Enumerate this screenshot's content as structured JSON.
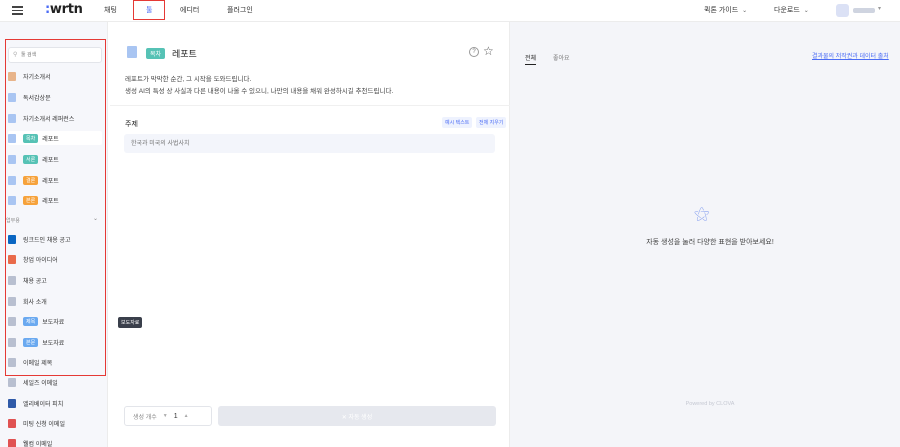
{
  "nav": {
    "logo_mark": ":",
    "logo_text": "wrtn",
    "tabs": [
      "채팅",
      "툴",
      "에디터",
      "플러그인"
    ],
    "active_tab": "툴",
    "quick_guide": "퀵톤 가이드",
    "download": "다운로드"
  },
  "sidebar": {
    "search_placeholder": "툴 검색",
    "items": [
      {
        "label": "자기소개서",
        "tag": "",
        "tag_color": "",
        "icon_color": "#e8b48a"
      },
      {
        "label": "독서감상문",
        "tag": "",
        "tag_color": "",
        "icon_color": "#a9c5f2"
      },
      {
        "label": "자기소개서 레퍼런스",
        "tag": "",
        "tag_color": "",
        "icon_color": "#a9c5f2"
      },
      {
        "label": "레포트",
        "tag": "목차",
        "tag_color": "#56c2b5",
        "icon_color": "#a9c5f2"
      },
      {
        "label": "레포트",
        "tag": "서론",
        "tag_color": "#56c2b5",
        "icon_color": "#a9c5f2"
      },
      {
        "label": "레포트",
        "tag": "결론",
        "tag_color": "#f6a23b",
        "icon_color": "#a9c5f2"
      },
      {
        "label": "레포트",
        "tag": "본론",
        "tag_color": "#f6a23b",
        "icon_color": "#a9c5f2"
      }
    ],
    "section_label": "업무용",
    "work_items": [
      {
        "label": "링크드인 채용 공고",
        "tag": "",
        "tag_color": "",
        "icon_color": "#0a66c2"
      },
      {
        "label": "창업 아이디어",
        "tag": "",
        "tag_color": "",
        "icon_color": "#e96a4a"
      },
      {
        "label": "채용 공고",
        "tag": "",
        "tag_color": "",
        "icon_color": "#b8bfd0"
      },
      {
        "label": "회사 소개",
        "tag": "",
        "tag_color": "",
        "icon_color": "#b8bfd0"
      },
      {
        "label": "보도자료",
        "tag": "제목",
        "tag_color": "#6aa9f0",
        "icon_color": "#b8bfd0"
      },
      {
        "label": "보도자료",
        "tag": "본문",
        "tag_color": "#6aa9f0",
        "icon_color": "#b8bfd0"
      },
      {
        "label": "이메일 제목",
        "tag": "",
        "tag_color": "",
        "icon_color": "#b8bfd0"
      },
      {
        "label": "세일즈 이메일",
        "tag": "",
        "tag_color": "",
        "icon_color": "#b8bfd0"
      },
      {
        "label": "엘리베이터 피치",
        "tag": "",
        "tag_color": "",
        "icon_color": "#2f5aa8"
      },
      {
        "label": "미팅 신청 이메일",
        "tag": "",
        "tag_color": "",
        "icon_color": "#e05252"
      },
      {
        "label": "웰컴 이메일",
        "tag": "",
        "tag_color": "",
        "icon_color": "#e05252"
      }
    ],
    "tooltip": "보도자료"
  },
  "main": {
    "tag": "목차",
    "title": "레포트",
    "description_1": "레포트가 막막한 순간, 그 시작을 도와드립니다.",
    "description_2": "생성 AI의 특성 상 사실과 다른 내용이 나올 수 있으니, 나만의 내용을 채워 완성하시길 추천드립니다.",
    "field_label": "주제",
    "example_button": "예시 텍스트",
    "clear_button": "전체 지우기",
    "topic_placeholder": "한국과 미국의 사법사치",
    "count_label": "생성 개수",
    "count_value": "1",
    "generate_button": "자동 생성"
  },
  "right": {
    "tabs": [
      "전체",
      "좋아요"
    ],
    "active_tab": "전체",
    "link": "결과물의 저작권과 데이터 출처",
    "empty_message": "자동 생성을 눌러 다양한 표현을 받아보세요!",
    "powered_by": "Powered by CLOVA"
  },
  "colors": {
    "accent": "#4b6cf5",
    "highlight_box": "#e53935"
  }
}
